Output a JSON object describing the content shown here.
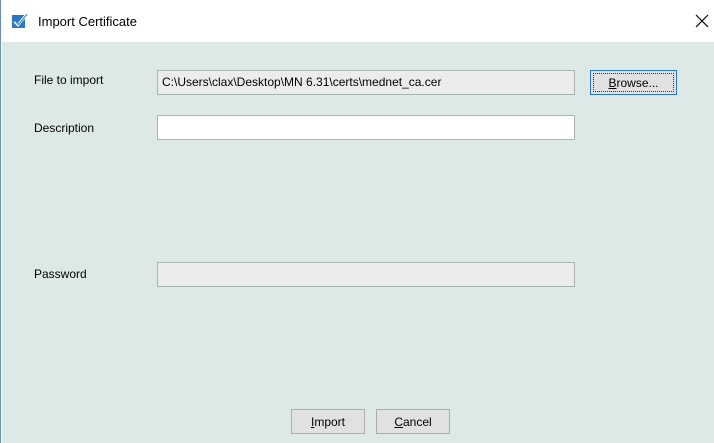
{
  "window": {
    "title": "Import Certificate",
    "title_icon": "checkbox-check-icon",
    "close_icon": "close-icon",
    "accent_color": "#2b78c8",
    "client_bg": "#dce9e7"
  },
  "form": {
    "file_label": "File to import",
    "file_value": "C:\\Users\\clax\\Desktop\\MN 6.31\\certs\\mednet_ca.cer",
    "browse_label": {
      "mnemonic": "B",
      "rest": "rowse..."
    },
    "description_label": "Description",
    "description_value": "",
    "password_label": "Password",
    "password_value": ""
  },
  "buttons": {
    "import_label": {
      "mnemonic": "I",
      "rest": "mport"
    },
    "cancel_label": {
      "mnemonic": "C",
      "rest": "ancel"
    }
  }
}
